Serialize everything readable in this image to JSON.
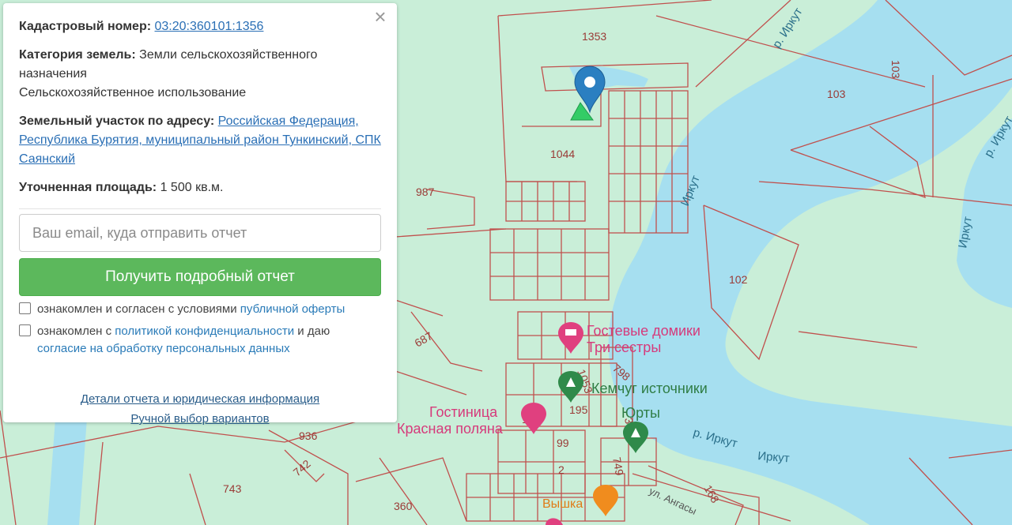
{
  "panel": {
    "close_symbol": "×",
    "cadastral_label": "Кадастровый номер:",
    "cadastral_value": "03:20:360101:1356",
    "category_label": "Категория земель:",
    "category_value": "Земли сельскохозяйственного назначения",
    "usage_value": "Сельскохозяйственное использование",
    "address_label": "Земельный участок по адресу:",
    "address_value": "Российская Федерация, Республика Бурятия, муниципальный район Тункинский, СПК Саянский",
    "area_label": "Уточненная площадь:",
    "area_value": "1 500 кв.м.",
    "email_placeholder": "Ваш email, куда отправить отчет",
    "submit_label": "Получить подробный отчет",
    "consent1_text": "ознакомлен и согласен с условиями ",
    "consent1_link": "публичной оферты",
    "consent2_text_a": "ознакомлен с ",
    "consent2_link_a": "политикой конфиденциальности",
    "consent2_text_b": " и даю ",
    "consent2_link_b": "согласие на обработку персональных данных",
    "details_link": "Детали отчета и юридическая информация",
    "manual_link": "Ручной выбор вариантов"
  },
  "map": {
    "parcel_labels": [
      "1353",
      "103",
      "103",
      "1044",
      "987",
      "102",
      "687",
      "1053",
      "195",
      "798",
      "198",
      "348",
      "99",
      "749",
      "936",
      "742",
      "743",
      "360",
      "2",
      "168"
    ],
    "river_labels": [
      "р. Иркут",
      "р. Иркут",
      "Иркут",
      "Иркут",
      "р. Иркут",
      "Иркут"
    ],
    "poi": {
      "guest_houses": [
        "Гостевые домики",
        "Три сестры"
      ],
      "springs": "Кемчуг источники",
      "yurts": "Юрты",
      "hotel": [
        "Гостиница",
        "Красная поляна"
      ],
      "tower": "Вышка"
    },
    "street": "ул. Ангасы",
    "colors": {
      "land": "#c9eed8",
      "water": "#a6dff0",
      "parcel_line": "#c0504d",
      "marker": "#2b7fc1"
    }
  }
}
